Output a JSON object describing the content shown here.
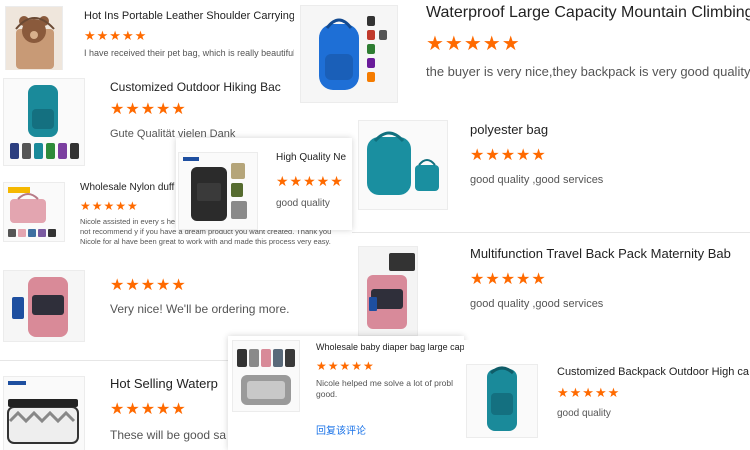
{
  "colors": {
    "star": "#ff6a00",
    "title": "#222222",
    "review": "#555555",
    "reply_link": "#1a73e8"
  },
  "reviews": [
    {
      "title": "Hot Ins Portable Leather Shoulder Carrying Sm",
      "stars": "★★★★★",
      "text": "I have received their pet bag, which is really beautiful a",
      "thumb_icon": "teddy-bear-bag-photo"
    },
    {
      "title": "Waterproof Large Capacity Mountain Climbing",
      "stars": "★★★★★",
      "text": "the buyer is very nice,they backpack is very good quality",
      "thumb_icon": "blue-backpack-photo"
    },
    {
      "title": "Customized Outdoor Hiking Bac",
      "stars": "★★★★★",
      "text": "Gute Qualität  vielen Dank",
      "thumb_icon": "teal-hiking-backpack-photo"
    },
    {
      "title": "polyester bag",
      "stars": "★★★★★",
      "text": "good quality ,good services",
      "thumb_icon": "foldable-teal-bag-photo"
    },
    {
      "title": "High Quality Ne",
      "stars": "★★★★★",
      "text": "good quality",
      "thumb_icon": "tactical-backpack-photo"
    },
    {
      "title": "Wholesale Nylon duff",
      "stars": "★★★★★",
      "text": "Nicole assisted in every s he listened to us and catered to all our needs. we could not recommend y if you have a dream product you want created. Thank you Nicole for al have been great to work with and made this process very easy.",
      "thumb_icon": "pink-duffel-bag-photo"
    },
    {
      "title": "Multifunction Travel Back Pack Maternity Bab",
      "stars": "★★★★★",
      "text": "good quality ,good services",
      "thumb_icon": "maternity-backpack-photo"
    },
    {
      "title": "",
      "stars": "★★★★★",
      "text": "Very nice! We'll be ordering more.",
      "thumb_icon": "pink-diaper-backpack-photo"
    },
    {
      "title": "Wholesale baby diaper bag large capacity trave...",
      "stars": "★★★★★",
      "text": "Nicole helped me solve a lot of probl good.",
      "reply": "回复该评论",
      "thumb_icon": "diaper-bag-set-photo"
    },
    {
      "title": "Customized Backpack Outdoor High ca",
      "stars": "★★★★★",
      "text": "good quality",
      "thumb_icon": "teal-outdoor-backpack-photo"
    },
    {
      "title": "Hot Selling Waterp",
      "stars": "★★★★★",
      "text": "These will be good sa",
      "thumb_icon": "stroller-organizer-photo"
    }
  ]
}
